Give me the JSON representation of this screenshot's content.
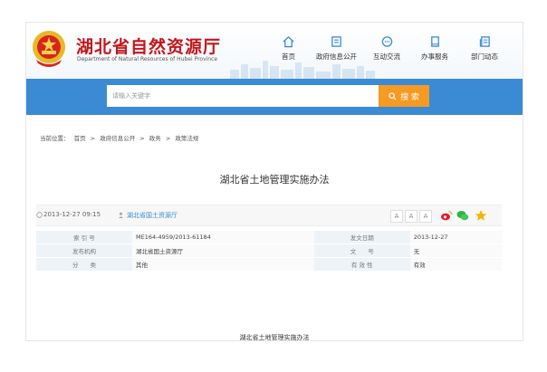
{
  "site": {
    "title": "湖北省自然资源厅",
    "subtitle": "Department of Natural Resources of Hubei Province"
  },
  "nav": [
    {
      "label": "首页",
      "icon": "home-icon"
    },
    {
      "label": "政府信息公开",
      "icon": "document-icon"
    },
    {
      "label": "互动交流",
      "icon": "chat-icon"
    },
    {
      "label": "办事服务",
      "icon": "bookmark-icon"
    },
    {
      "label": "部门动态",
      "icon": "news-icon"
    }
  ],
  "search": {
    "placeholder": "请输入关键字",
    "button_label": "搜 索"
  },
  "breadcrumb": [
    "当前位置：",
    "首页",
    ">",
    "政府信息公开",
    ">",
    "政务",
    ">",
    "政策法规"
  ],
  "article": {
    "title": "湖北省土地管理实施办法",
    "date": "2013-12-27 09:15",
    "source": "湖北省国土资源厅",
    "font_sizes": [
      "A",
      "A",
      "A"
    ],
    "doc_heading": "湖北省土地管理实施办法"
  },
  "info_table": [
    [
      {
        "k": "索 引 号",
        "v": "ME164-4959/2013-61184"
      },
      {
        "k": "发文日期",
        "v": "2013-12-27"
      }
    ],
    [
      {
        "k": "发布机构",
        "v": "湖北省国土资源厅"
      },
      {
        "k": "文　　号",
        "v": "无"
      }
    ],
    [
      {
        "k": "分　　类",
        "v": "其他"
      },
      {
        "k": "有 效 性",
        "v": "有效"
      }
    ]
  ],
  "colors": {
    "brand_red": "#c4161c",
    "search_band": "#3b8ad4",
    "search_button": "#f59a23"
  }
}
